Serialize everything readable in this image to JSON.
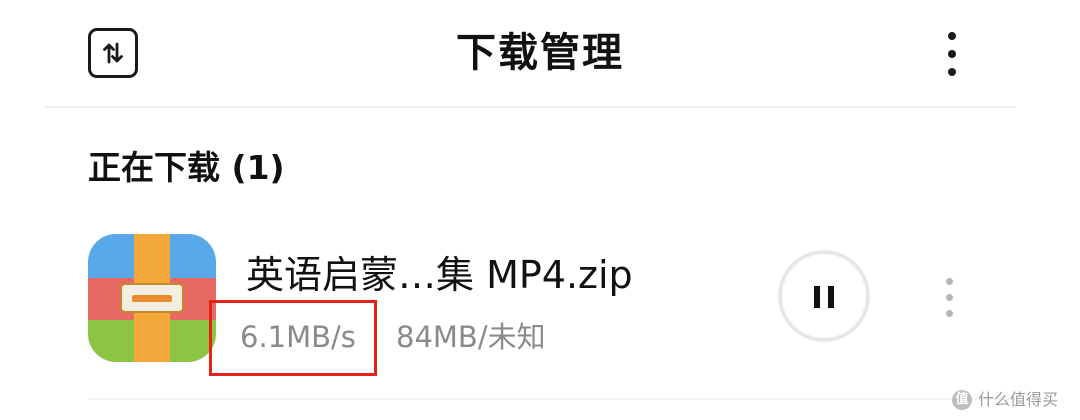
{
  "header": {
    "title": "下载管理",
    "left_icon": "sort-arrows-icon",
    "right_icon": "more-vertical-icon"
  },
  "section": {
    "title": "正在下载 (1)"
  },
  "downloads": [
    {
      "file_name": "英语启蒙…集 MP4.zip",
      "speed": "6.1MB/s",
      "size": "84MB/未知",
      "app_icon": "archive-app-icon",
      "action_icon": "pause-icon",
      "menu_icon": "more-vertical-icon"
    }
  ],
  "colors": {
    "highlight": "#e6211a",
    "secondary_text": "#8a8a8a"
  },
  "watermark": {
    "badge": "值",
    "text": "什么值得买"
  }
}
